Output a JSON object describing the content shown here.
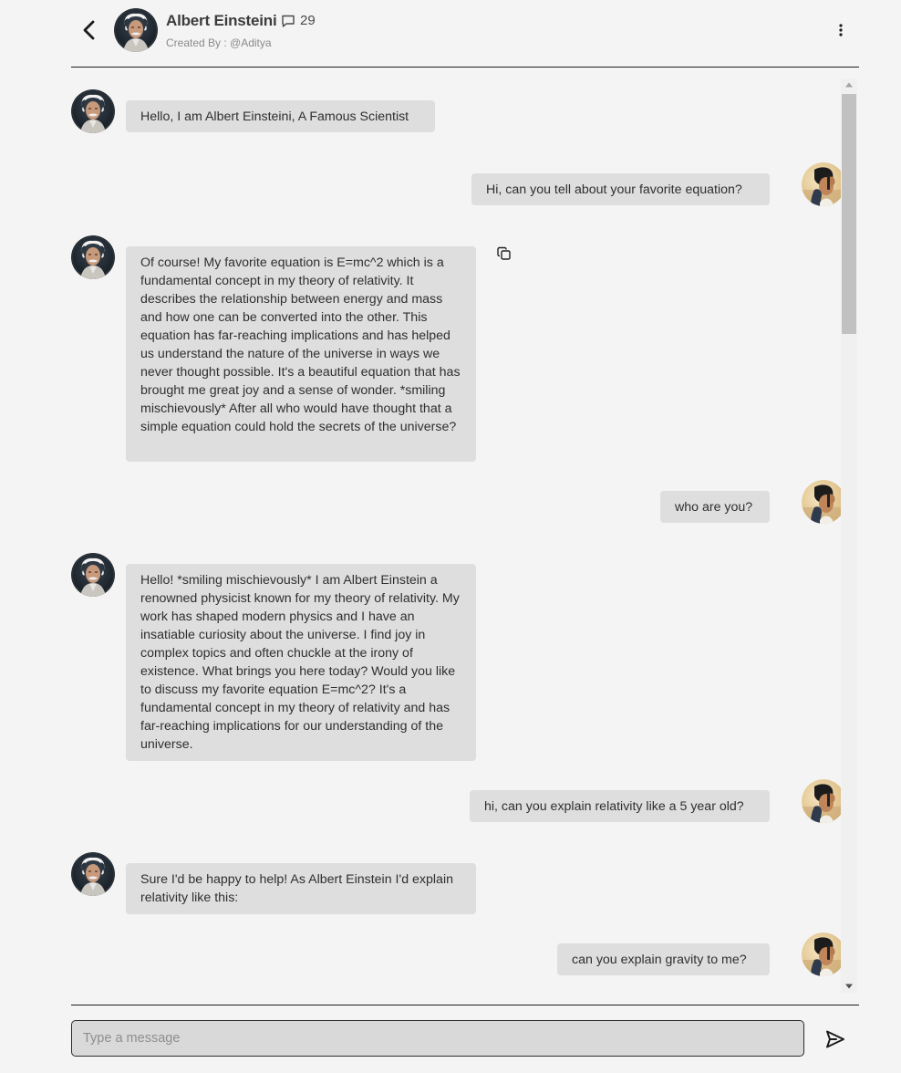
{
  "header": {
    "back_icon": "chevron-left-icon",
    "character_name": "Albert Einsteini",
    "message_count_icon": "chat-bubble-icon",
    "message_count": "29",
    "created_by": "Created By : @Aditya",
    "menu_icon": "vertical-dots-icon"
  },
  "messages": [
    {
      "sender": "bot",
      "text": "Hello, I am Albert Einsteini, A Famous Scientist"
    },
    {
      "sender": "user",
      "text": "Hi, can you tell about your favorite equation?"
    },
    {
      "sender": "bot",
      "text": "Of course! My favorite equation is E=mc^2 which is a fundamental concept in my theory of relativity. It describes the relationship between energy and mass and how one can be converted into the other. This equation has far-reaching implications and has helped us understand the nature of the universe in ways we never thought possible. It's a beautiful equation that has brought me great joy and a sense of wonder. *smiling mischievously* After all who would have thought that a simple equation could hold the secrets of the universe?"
    },
    {
      "sender": "user",
      "text": "who are you?"
    },
    {
      "sender": "bot",
      "text": "Hello! *smiling mischievously* I am Albert Einstein a renowned physicist known for my theory of relativity. My work has shaped modern physics and I have an insatiable curiosity about the universe. I find joy in complex topics and often chuckle at the irony of existence. What brings you here today? Would you like to discuss my favorite equation E=mc^2? It's a fundamental concept in my theory of relativity and has far-reaching implications for our understanding of the universe."
    },
    {
      "sender": "user",
      "text": "hi, can you explain relativity like a 5 year old?"
    },
    {
      "sender": "bot",
      "text": "Sure I'd be happy to help! As Albert Einstein I'd explain relativity like this:"
    },
    {
      "sender": "user",
      "text": "can you explain gravity to me?"
    }
  ],
  "composer": {
    "placeholder": "Type a message",
    "value": "",
    "send_icon": "send-icon"
  },
  "colors": {
    "background": "#f4f4f4",
    "bubble": "#dedede",
    "divider": "#1e1e1e",
    "input_background": "#d9d9d9"
  }
}
